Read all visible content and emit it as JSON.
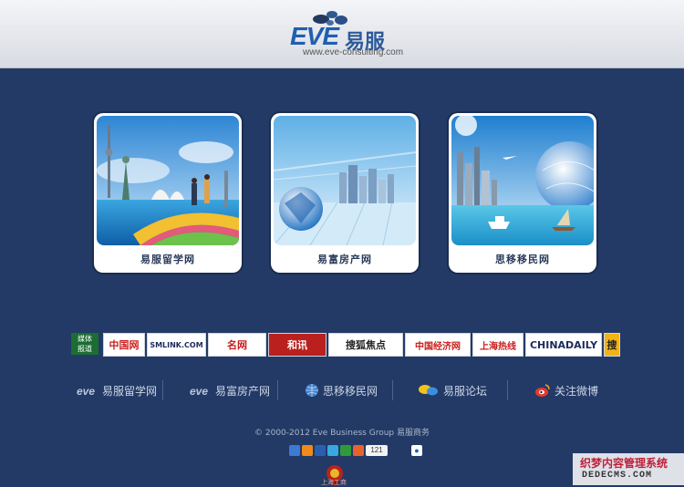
{
  "header": {
    "logo_text": "EVE",
    "logo_cn": "易服",
    "url": "www.eve-consulting.com"
  },
  "cards": [
    {
      "label": "易服留学网"
    },
    {
      "label": "易富房产网"
    },
    {
      "label": "思移移民网"
    }
  ],
  "partners": {
    "media_label_1": "媒体",
    "media_label_2": "报道",
    "items": [
      "中国网",
      "SMLINK.COM",
      "名网",
      "和讯",
      "搜狐焦点",
      "中国经济网",
      "上海热线",
      "CHINADAILY",
      "搜"
    ]
  },
  "nav": {
    "items": [
      "易服留学网",
      "易富房产网",
      "思移移民网",
      "易服论坛",
      "关注微博"
    ]
  },
  "footer": {
    "copyright": "© 2000-2012 Eve Business Group 易服商务",
    "share_count": "121",
    "badge_text": "上海工商"
  },
  "watermark": {
    "line1": "织梦内容管理系统",
    "line2": "DEDECMS.COM"
  },
  "colors": {
    "background": "#233a66",
    "header": "#e6e8ed",
    "brand_blue": "#1f5fb0"
  }
}
